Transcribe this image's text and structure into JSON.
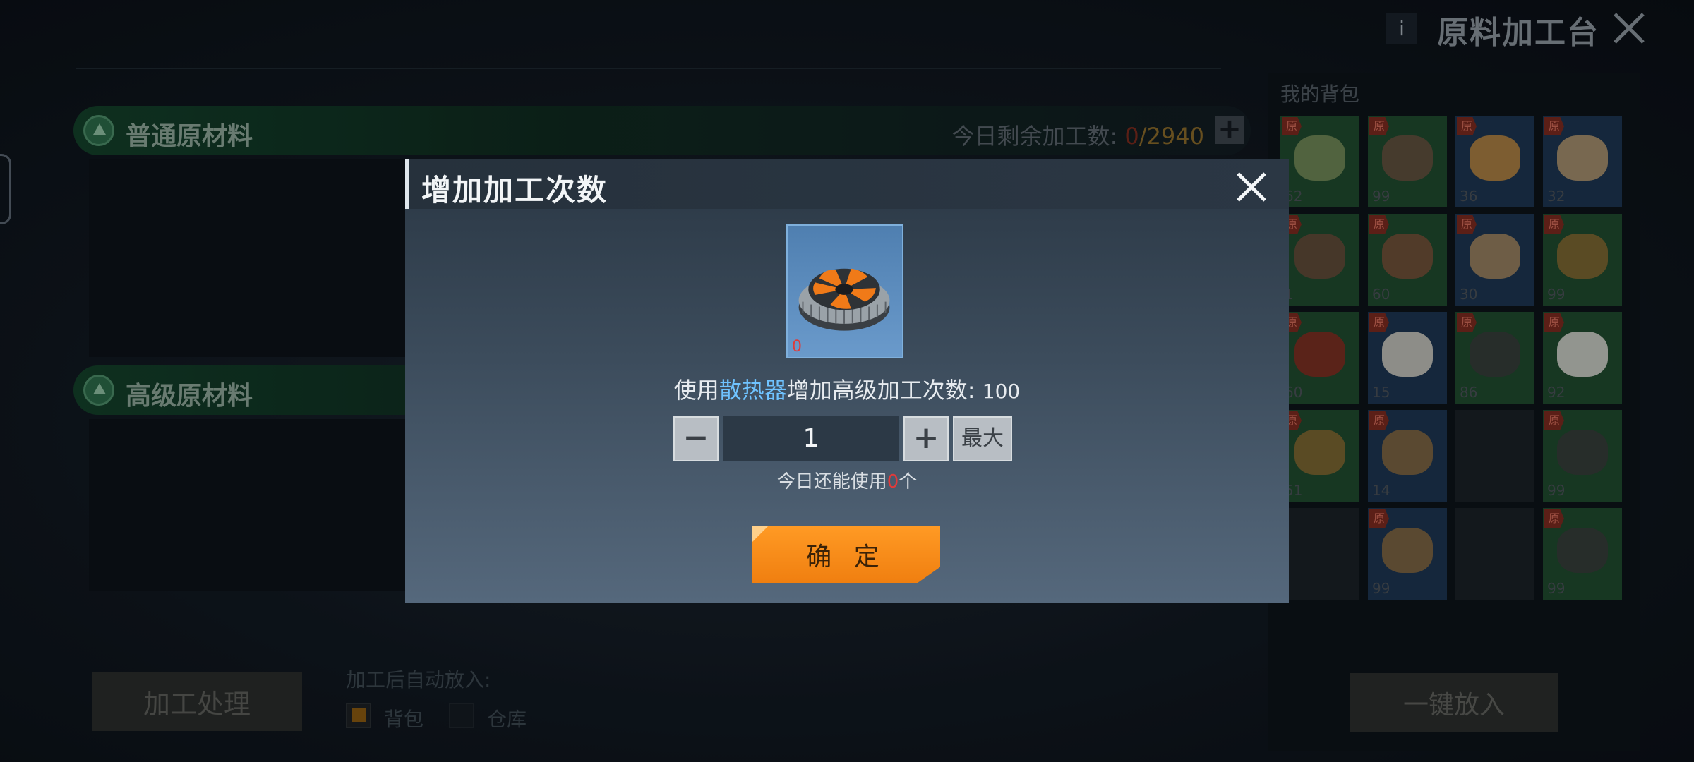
{
  "header": {
    "info_icon": "i",
    "title": "原料加工台",
    "close_icon": "close-icon"
  },
  "categories": [
    {
      "title": "普通原材料",
      "remain_label": "今日剩余加工数:",
      "remain_current": "0",
      "remain_total": "/2940"
    },
    {
      "title": "高级原材料"
    }
  ],
  "footer": {
    "process_button": "加工处理",
    "auto_label": "加工后自动放入:",
    "option_bag": "背包",
    "option_warehouse": "仓库",
    "option_bag_checked": true
  },
  "backpack": {
    "title": "我的背包",
    "tag": "原",
    "slots": [
      {
        "count": "62",
        "color": "#7a8f5a"
      },
      {
        "count": "99",
        "color": "#6a5040"
      },
      {
        "count": "36",
        "color": "#c08a40"
      },
      {
        "count": "32",
        "color": "#b89a70"
      },
      {
        "count": "1",
        "color": "#6a4a38"
      },
      {
        "count": "60",
        "color": "#7a5038"
      },
      {
        "count": "30",
        "color": "#a88a60"
      },
      {
        "count": "99",
        "color": "#8a6a30"
      },
      {
        "count": "60",
        "color": "#8a2a20"
      },
      {
        "count": "15",
        "color": "#d8d4c8"
      },
      {
        "count": "86",
        "color": "#3a3a3a"
      },
      {
        "count": "92",
        "color": "#e0ddd8"
      },
      {
        "count": "51",
        "color": "#8a6a30"
      },
      {
        "count": "14",
        "color": "#8a6a40"
      },
      {
        "count": "",
        "color": ""
      },
      {
        "count": "99",
        "color": "#3a3a3a"
      },
      {
        "count": "",
        "color": ""
      },
      {
        "count": "99",
        "color": "#8a6a40"
      },
      {
        "count": "",
        "color": ""
      },
      {
        "count": "99",
        "color": "#3a3a3a"
      }
    ],
    "onekey_button": "一键放入"
  },
  "dialog": {
    "title": "增加加工次数",
    "item_name": "散热器",
    "item_count": "0",
    "use_prefix": "使用",
    "use_suffix": "增加高级加工次数:",
    "use_amount": "100",
    "quantity": "1",
    "minus": "−",
    "plus": "+",
    "max_button": "最大",
    "remain_prefix": "今日还能使用",
    "remain_value": "0",
    "remain_suffix": "个",
    "confirm_button": "确 定"
  },
  "colors": {
    "accent_orange": "#f7901a",
    "highlight_blue": "#6fc3ff",
    "warning_red": "#e03a3a"
  }
}
